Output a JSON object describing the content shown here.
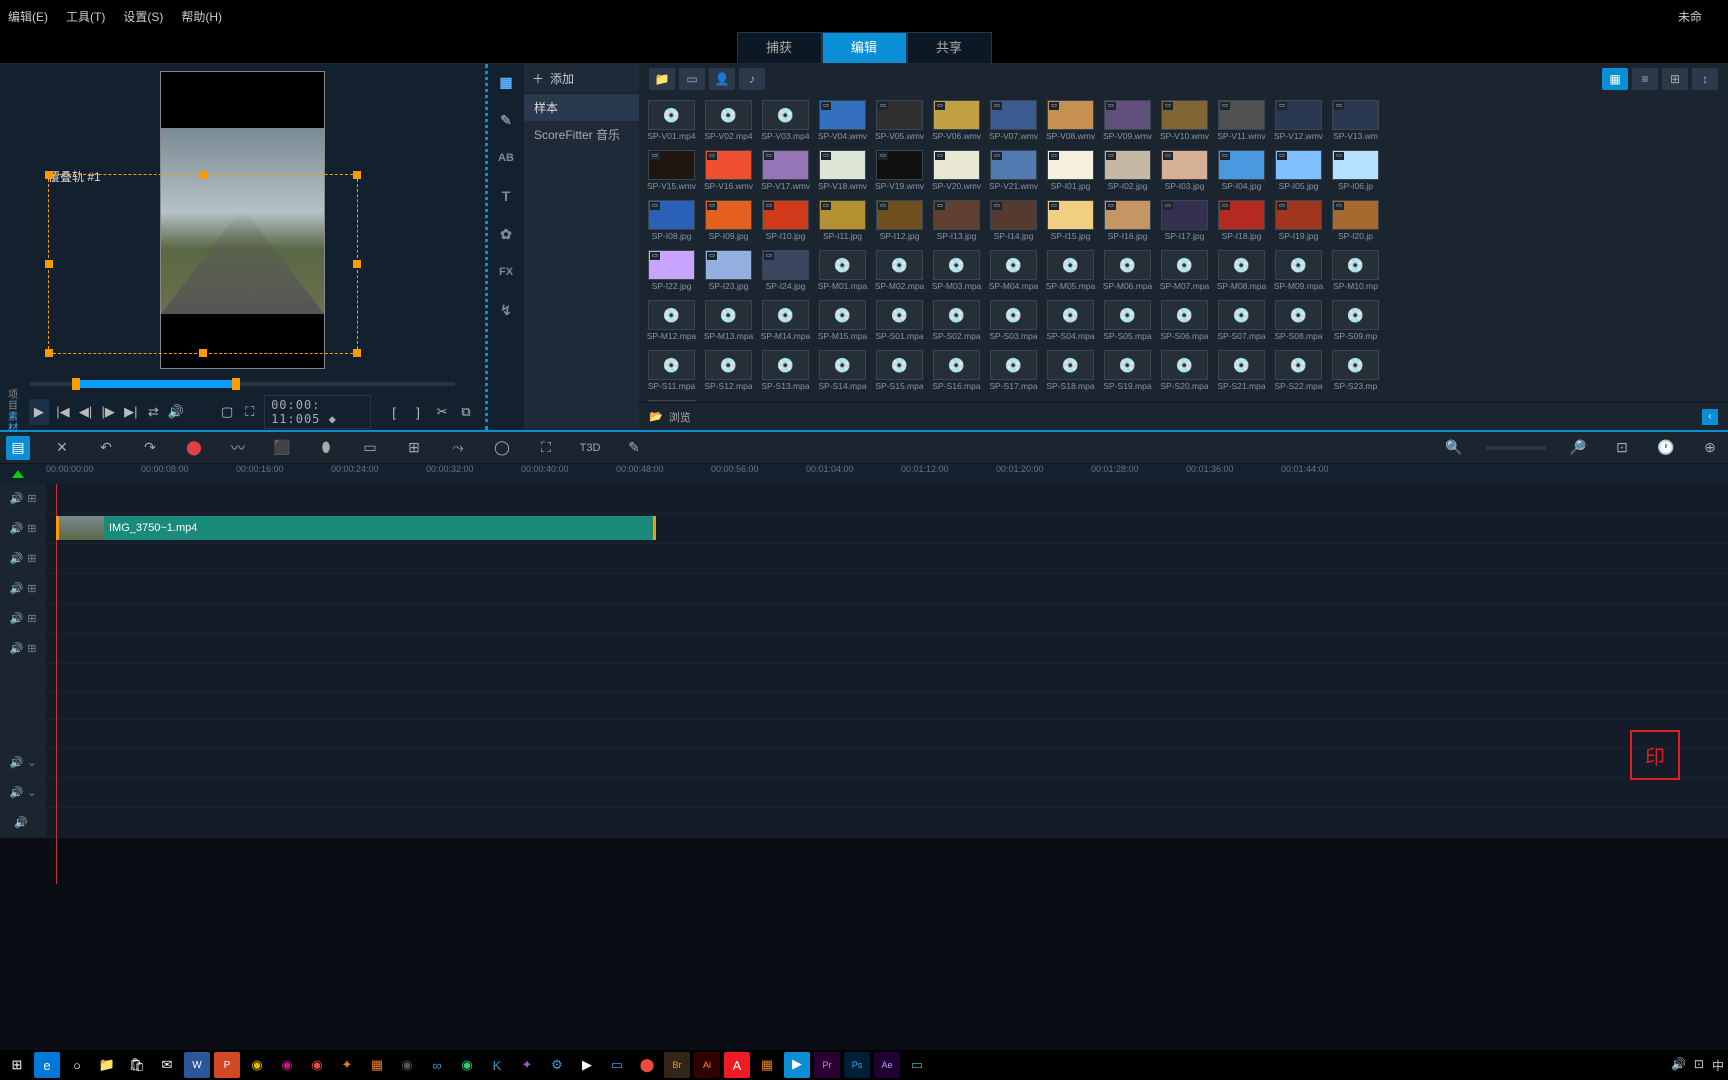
{
  "menu": {
    "edit": "编辑(E)",
    "tools": "工具(T)",
    "settings": "设置(S)",
    "help": "帮助(H)",
    "unsaved": "未命"
  },
  "tabs": {
    "capture": "捕获",
    "edit": "编辑",
    "share": "共享"
  },
  "preview": {
    "overlay_label": "覆叠轨 #1",
    "labels": {
      "project": "项目",
      "clip": "素材"
    },
    "timecode": "00:00: 11:005 ◆"
  },
  "library": {
    "add": "添加",
    "cats": [
      "样本",
      "ScoreFitter 音乐"
    ],
    "browse": "浏览",
    "assets_row1": [
      "SP-V01.mp4",
      "SP-V02.mp4",
      "SP-V03.mp4",
      "SP-V04.wmv",
      "SP-V05.wmv",
      "SP-V06.wmv",
      "SP-V07.wmv",
      "SP-V08.wmv",
      "SP-V09.wmv",
      "SP-V10.wmv",
      "SP-V11.wmv",
      "SP-V12.wmv",
      "SP-V13.wm"
    ],
    "assets_row2": [
      "SP-V15.wmv",
      "SP-V16.wmv",
      "SP-V17.wmv",
      "SP-V18.wmv",
      "SP-V19.wmv",
      "SP-V20.wmv",
      "SP-V21.wmv",
      "SP-I01.jpg",
      "SP-I02.jpg",
      "SP-I03.jpg",
      "SP-I04.jpg",
      "SP-I05.jpg",
      "SP-I06.jp"
    ],
    "assets_row3": [
      "SP-I08.jpg",
      "SP-I09.jpg",
      "SP-I10.jpg",
      "SP-I11.jpg",
      "SP-I12.jpg",
      "SP-I13.jpg",
      "SP-I14.jpg",
      "SP-I15.jpg",
      "SP-I16.jpg",
      "SP-I17.jpg",
      "SP-I18.jpg",
      "SP-I19.jpg",
      "SP-I20.jp"
    ],
    "assets_row4": [
      "SP-I22.jpg",
      "SP-I23.jpg",
      "SP-I24.jpg",
      "SP-M01.mpa",
      "SP-M02.mpa",
      "SP-M03.mpa",
      "SP-M04.mpa",
      "SP-M05.mpa",
      "SP-M06.mpa",
      "SP-M07.mpa",
      "SP-M08.mpa",
      "SP-M09.mpa",
      "SP-M10.mp"
    ],
    "assets_row5": [
      "SP-M12.mpa",
      "SP-M13.mpa",
      "SP-M14.mpa",
      "SP-M15.mpa",
      "SP-S01.mpa",
      "SP-S02.mpa",
      "SP-S03.mpa",
      "SP-S04.mpa",
      "SP-S05.mpa",
      "SP-S06.mpa",
      "SP-S07.mpa",
      "SP-S08.mpa",
      "SP-S09.mp"
    ],
    "assets_row6": [
      "SP-S11.mpa",
      "SP-S12.mpa",
      "SP-S13.mpa",
      "SP-S14.mpa",
      "SP-S15.mpa",
      "SP-S16.mpa",
      "SP-S17.mpa",
      "SP-S18.mpa",
      "SP-S19.mpa",
      "SP-S20.mpa",
      "SP-S21.mpa",
      "SP-S22.mpa",
      "SP-S23.mp"
    ]
  },
  "timeline": {
    "ticks": [
      "00:00:00:00",
      "00:00:08:00",
      "00:00:16:00",
      "00:00:24:00",
      "00:00:32:00",
      "00:00:40:00",
      "00:00:48:00",
      "00:00:56:00",
      "00:01:04:00",
      "00:01:12:00",
      "00:01:20:00",
      "00:01:28:00",
      "00:01:36:00",
      "00:01:44:00"
    ],
    "clip_name": "IMG_3750~1.mp4",
    "t3d_label": "T3D"
  },
  "thumb_colors": [
    "#c8a5ff",
    "#95b0e0",
    "#3a4560",
    "#3570c0",
    "#303030",
    "#c0a040",
    "#3a5a90",
    "#c89050",
    "#604f7a",
    "#806535",
    "#505050",
    "#2a3850",
    "#2a3850",
    "#201510",
    "#f05030",
    "#9575b5",
    "#dde5d5",
    "#101010",
    "#e8e8d5",
    "#507ab0",
    "#f5efe0",
    "#c5b8a5",
    "#d5b095",
    "#4a98e0",
    "#80c0ff",
    "#b5e0ff",
    "#2a60b5",
    "#e56020",
    "#d03a1a",
    "#b59030",
    "#705020",
    "#604030",
    "#553a30",
    "#f0d080",
    "#c59565",
    "#353050",
    "#b52a20",
    "#a03520",
    "#a56a30"
  ],
  "statusbar": {
    "ime": "中"
  }
}
